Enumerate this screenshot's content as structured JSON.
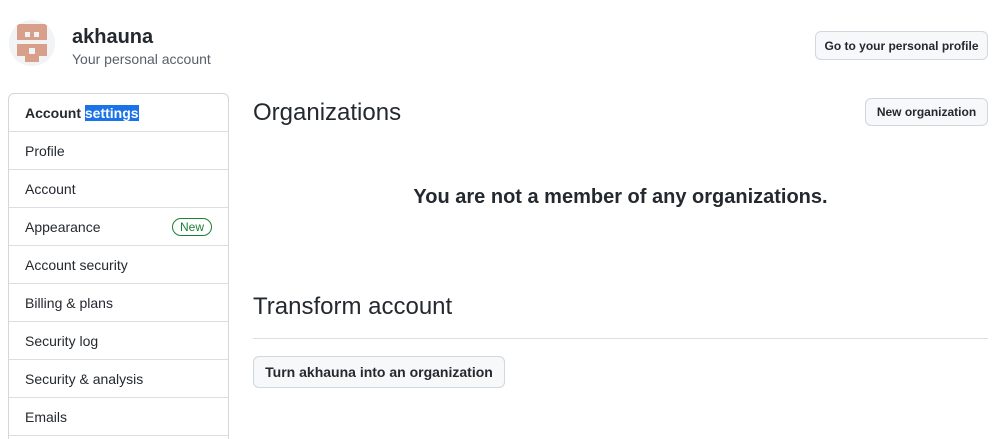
{
  "user": {
    "name": "akhauna",
    "subtitle": "Your personal account"
  },
  "header": {
    "profile_button": "Go to your personal profile"
  },
  "sidebar": {
    "header_prefix": "Account",
    "header_selected": "settings",
    "items": [
      {
        "label": "Profile"
      },
      {
        "label": "Account"
      },
      {
        "label": "Appearance",
        "badge": "New"
      },
      {
        "label": "Account security"
      },
      {
        "label": "Billing & plans"
      },
      {
        "label": "Security log"
      },
      {
        "label": "Security & analysis"
      },
      {
        "label": "Emails"
      }
    ]
  },
  "organizations": {
    "title": "Organizations",
    "new_button": "New organization",
    "empty_message": "You are not a member of any organizations."
  },
  "transform": {
    "title": "Transform account",
    "button": "Turn akhauna into an organization"
  },
  "colors": {
    "selection": "#1a73e8",
    "badge_green": "#1a7f37",
    "avatar_brown": "#d8a08a"
  }
}
